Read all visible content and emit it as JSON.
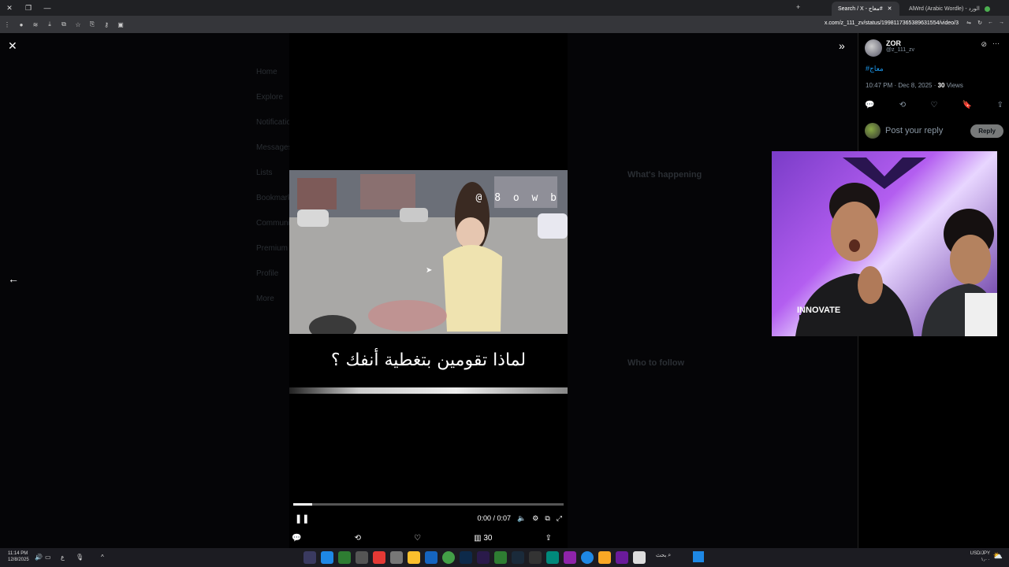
{
  "browser": {
    "tabs": [
      {
        "label": "Search / X - معاج#",
        "active": true
      },
      {
        "label": "AlWrd (Arabic Wordle) - الورد",
        "active": false
      }
    ],
    "url": "x.com/z_111_zv/status/1998117365389631554/video/3"
  },
  "background_nav": [
    "Home",
    "Explore",
    "Notifications",
    "Messages",
    "Lists",
    "Bookmarks",
    "Communities",
    "Premium",
    "Profile",
    "More"
  ],
  "background_right": {
    "whats_happening": "What's happening",
    "who_to_follow": "Who to follow"
  },
  "video": {
    "watermark": "@ 8 o w b",
    "caption": "لماذا تقومين بتغطية أنفك ؟",
    "time": "0:00 / 0:07",
    "progress_fraction": 0.07
  },
  "tweet_actions": {
    "views": "30"
  },
  "sidebar": {
    "author_name": "ZOR",
    "author_handle": "@z_111_zv",
    "hashtag": "#معاج",
    "timestamp": "10:47 PM · Dec 8, 2025 · ",
    "views_count": "30",
    "views_label": " Views",
    "reply_placeholder": "Post your reply",
    "reply_button": "Reply"
  },
  "taskbar": {
    "time": "11:14 PM",
    "date": "12/8/2025",
    "lang": "ع",
    "search_label": "بحث",
    "currency": "USD/JPY",
    "currency_value": "۱٫۰۰"
  }
}
